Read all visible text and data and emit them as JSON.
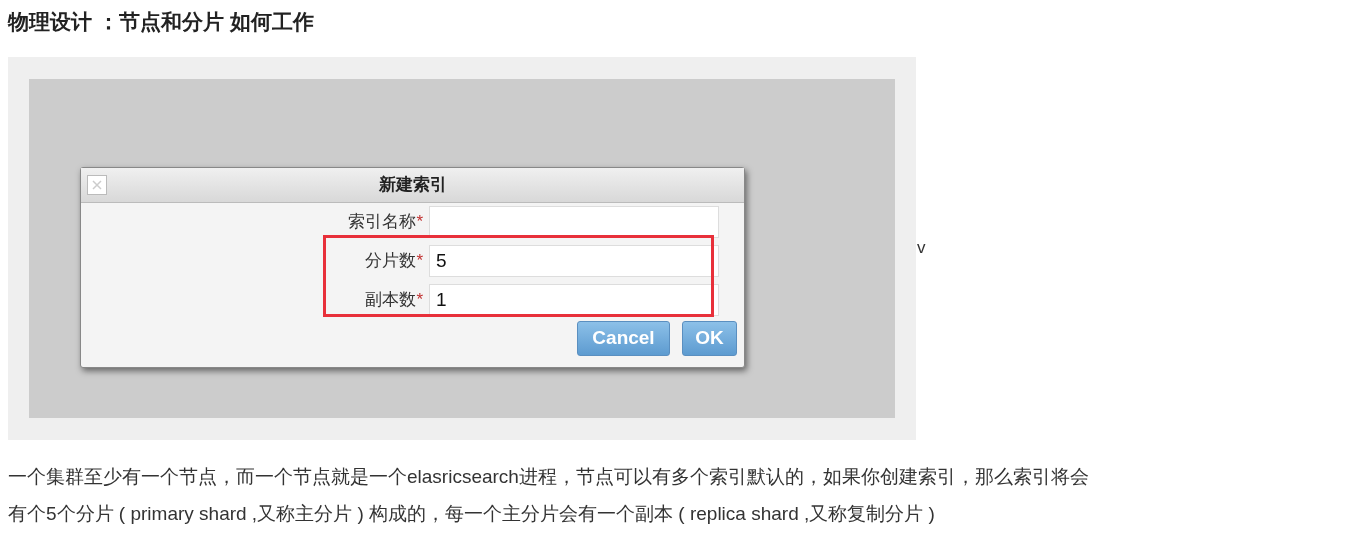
{
  "heading": "物理设计 ：节点和分片 如何工作",
  "dialog": {
    "title": "新建索引",
    "fields": [
      {
        "label": "索引名称",
        "mark": "*"
      },
      {
        "label": "分片数",
        "mark": "*",
        "value": "5"
      },
      {
        "label": "副本数",
        "mark": "*",
        "value": "1"
      }
    ],
    "buttons": [
      "Cancel",
      "OK"
    ]
  },
  "side_note": "v",
  "paragraph_lines": [
    "一个集群至少有一个节点，而一个节点就是一个elasricsearch进程，节点可以有多个索引默认的，如果你创建索引，那么索引将会",
    "有个5个分片 ( primary shard ,又称主分片 ) 构成的，每一个主分片会有一个副本 ( replica shard ,又称复制分片 )"
  ]
}
